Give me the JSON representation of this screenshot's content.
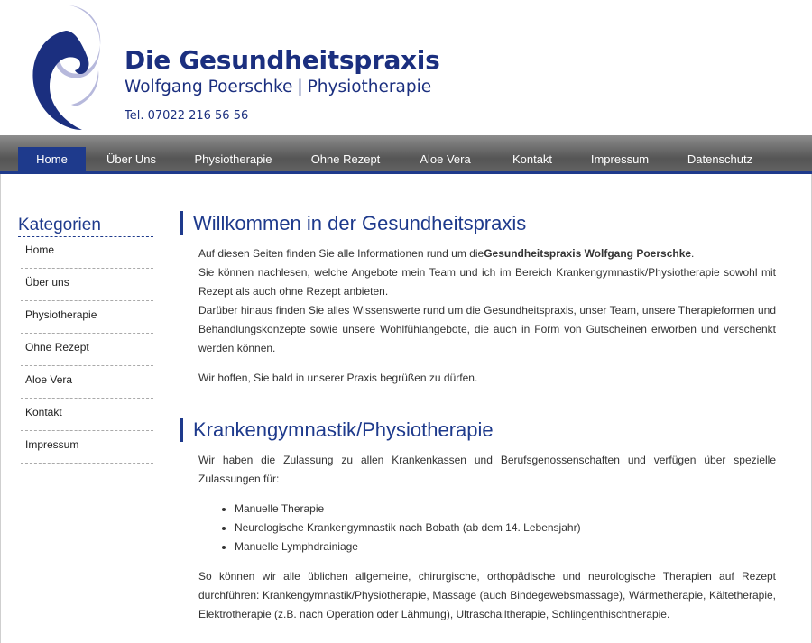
{
  "header": {
    "title": "Die Gesundheitspraxis",
    "subtitle_name": "Wolfgang Poerschke",
    "subtitle_separator": "|",
    "subtitle_field": "Physiotherapie",
    "phone": "Tel. 07022 216 56 56"
  },
  "colors": {
    "brand_blue": "#1e3a8c",
    "nav_gray": "#6e6e6e",
    "logo_light": "#b7b9dc"
  },
  "nav": {
    "items": [
      {
        "label": "Home",
        "active": true
      },
      {
        "label": "Über Uns"
      },
      {
        "label": "Physiotherapie"
      },
      {
        "label": "Ohne Rezept"
      },
      {
        "label": "Aloe Vera"
      },
      {
        "label": "Kontakt"
      },
      {
        "label": "Impressum"
      },
      {
        "label": "Datenschutz"
      }
    ]
  },
  "sidebar": {
    "title": "Kategorien",
    "items": [
      {
        "label": "Home"
      },
      {
        "label": "Über uns"
      },
      {
        "label": "Physiotherapie"
      },
      {
        "label": "Ohne Rezept"
      },
      {
        "label": "Aloe Vera"
      },
      {
        "label": "Kontakt"
      },
      {
        "label": "Impressum"
      }
    ]
  },
  "main": {
    "welcome": {
      "heading": "Willkommen in der Gesundheitspraxis",
      "p1_prefix": "Auf diesen Seiten finden Sie alle Informationen rund um die",
      "p1_bold": "Gesundheitspraxis Wolfgang Poerschke",
      "p1_suffix": ".",
      "p2": "Sie können nachlesen, welche Angebote mein Team und ich im Bereich Krankengymnastik/Physiotherapie sowohl mit Rezept als auch ohne Rezept anbieten.",
      "p3": "Darüber hinaus finden Sie alles Wissenswerte rund um die Gesundheitspraxis, unser Team, unsere Therapieformen und Behandlungskonzepte sowie unsere Wohlfühlangebote, die auch in Form von Gutscheinen erworben und verschenkt werden können.",
      "p4": "Wir hoffen, Sie bald in unserer Praxis begrüßen zu dürfen."
    },
    "physio": {
      "heading": "Krankengymnastik/Physiotherapie",
      "intro": "Wir haben die Zulassung zu allen Krankenkassen und Berufsgenossenschaften und verfügen über spezielle Zulassungen für:",
      "list": [
        "Manuelle Therapie",
        "Neurologische Krankengymnastik nach Bobath (ab dem 14. Lebensjahr)",
        "Manuelle Lymphdrainiage"
      ],
      "outro": "So können wir alle üblichen allgemeine, chirurgische, orthopädische und neurologische Therapien auf Rezept durchführen: Krankengymnastik/Physiotherapie, Massage (auch Bindegewebsmassage), Wärmetherapie, Kältetherapie, Elektrotherapie (z.B. nach Operation oder Lähmung), Ultraschalltherapie, Schlingenthischtherapie."
    }
  }
}
